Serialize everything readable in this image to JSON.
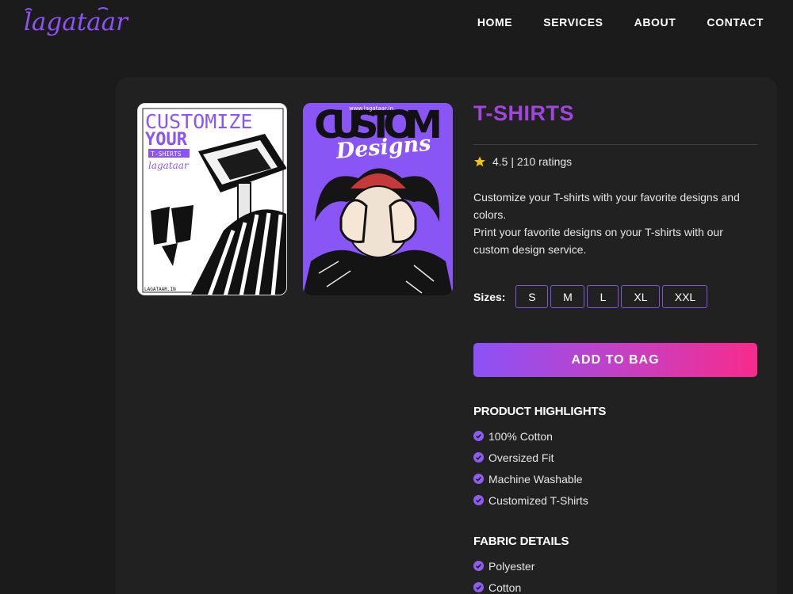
{
  "header": {
    "logo_text": "lagataar",
    "nav": [
      "HOME",
      "SERVICES",
      "ABOUT",
      "CONTACT"
    ]
  },
  "product": {
    "title": "T-SHIRTS",
    "rating": "4.5 | 210 ratings",
    "description": [
      "Customize your T-shirts with your favorite designs and colors.",
      "Print your favorite designs on your T-shirts with our custom design service."
    ],
    "sizes_label": "Sizes:",
    "sizes": [
      "S",
      "M",
      "L",
      "XL",
      "XXL"
    ],
    "add_to_bag": "ADD TO BAG",
    "highlights_title": "PRODUCT HIGHLIGHTS",
    "highlights": [
      "100% Cotton",
      "Oversized Fit",
      "Machine Washable",
      "Customized T-Shirts"
    ],
    "fabric_title": "FABRIC DETAILS",
    "fabric": [
      "Polyester",
      "Cotton"
    ]
  },
  "images": {
    "tile_a": {
      "line1": "CUSTOMIZE",
      "line2": "YOUR",
      "tag": "T-SHIRTS",
      "brand": "lagataar",
      "footer": "LAGATAAR.IN"
    },
    "tile_b": {
      "top_url": "www.lagataar.in",
      "headline": "CUSTOM",
      "script": "Designs"
    }
  },
  "colors": {
    "accent": "#a245e0",
    "star": "#f5c518",
    "check": "#8f5cf2",
    "button_gradient": [
      "#8b52f6",
      "#f72b8c"
    ]
  },
  "icons": [
    "star-icon",
    "check-circle-icon"
  ]
}
